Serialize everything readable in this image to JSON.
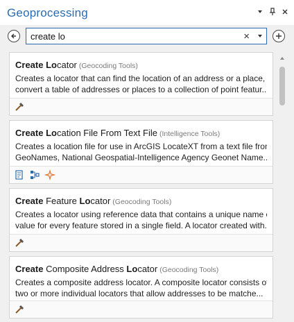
{
  "pane": {
    "title": "Geoprocessing"
  },
  "search": {
    "value": "create lo",
    "placeholder": ""
  },
  "results": [
    {
      "name_parts": [
        {
          "text": "Create",
          "bold": true
        },
        {
          "text": " ",
          "bold": false
        },
        {
          "text": "Lo",
          "bold": true
        },
        {
          "text": "cator",
          "bold": false
        }
      ],
      "category": "(Geocoding Tools)",
      "description": [
        "Creates a locator that can find the location of an address or a place,",
        "convert a table of addresses or places to a collection of point featur..."
      ],
      "icons": [
        "hammer-icon"
      ]
    },
    {
      "name_parts": [
        {
          "text": "Create",
          "bold": true
        },
        {
          "text": " ",
          "bold": false
        },
        {
          "text": "Lo",
          "bold": true
        },
        {
          "text": "cation File From Text File",
          "bold": false
        }
      ],
      "category": "(Intelligence Tools)",
      "description": [
        "Creates a location file for use in ArcGIS LocateXT from a text file from",
        "GeoNames, National Geospatial-Intelligence Agency Geonet Name..."
      ],
      "icons": [
        "script-icon",
        "model-icon",
        "sparkle-icon"
      ]
    },
    {
      "name_parts": [
        {
          "text": "Create",
          "bold": true
        },
        {
          "text": " Feature ",
          "bold": false
        },
        {
          "text": "Lo",
          "bold": true
        },
        {
          "text": "cator",
          "bold": false
        }
      ],
      "category": "(Geocoding Tools)",
      "description": [
        "Creates a locator using reference data that contains a unique name or",
        "value for every feature stored in a single field. A locator created with..."
      ],
      "icons": [
        "hammer-icon"
      ]
    },
    {
      "name_parts": [
        {
          "text": "Create",
          "bold": true
        },
        {
          "text": " Composite Address ",
          "bold": false
        },
        {
          "text": "Lo",
          "bold": true
        },
        {
          "text": "cator",
          "bold": false
        }
      ],
      "category": "(Geocoding Tools)",
      "description": [
        "Creates a composite address locator. A composite locator consists of",
        "two or more individual  locators that allow addresses to be matche..."
      ],
      "icons": [
        "hammer-icon"
      ]
    }
  ],
  "colors": {
    "accent": "#2b6cb0",
    "hammer_handle": "#8b5a2b",
    "tool_blue": "#2b6cb0",
    "sparkle": "#e07a3a"
  }
}
